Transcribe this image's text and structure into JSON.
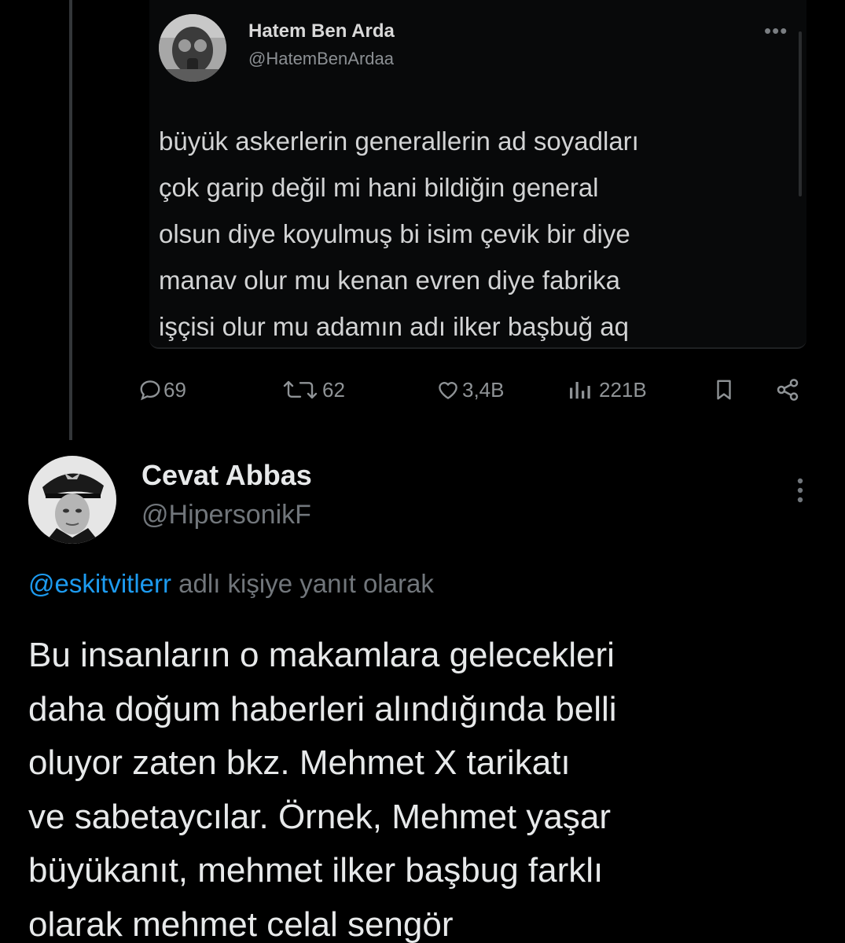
{
  "quoted_tweet": {
    "author_name": "Hatem Ben Arda",
    "author_handle": "@HatemBenArdaa",
    "more_label": "•••",
    "text": "büyük askerlerin generallerin ad soyadları\nçok garip değil mi hani bildiğin general\nolsun diye koyulmuş bi isim çevik bir diye\nmanav olur mu kenan evren diye fabrika\nişçisi olur mu adamın adı ilker başbuğ aq",
    "stats": {
      "replies": "69",
      "retweets": "62",
      "likes": "3,4B",
      "views": "221B"
    },
    "icons": [
      "reply-icon",
      "retweet-icon",
      "like-icon",
      "views-icon",
      "bookmark-icon",
      "share-icon"
    ]
  },
  "tweet": {
    "author_name": "Cevat Abbas",
    "author_handle": "@HipersonikF",
    "reply_mention": "@eskitvitlerr",
    "reply_suffix": " adlı kişiye yanıt olarak",
    "text": "Bu insanların o makamlara gelecekleri\ndaha doğum haberleri alındığında belli\noluyor zaten bkz. Mehmet X tarikatı\nve sabetaycılar. Örnek, Mehmet yaşar\nbüyükanıt, mehmet ilker başbug farklı\nolarak mehmet celal sengör"
  },
  "colors": {
    "background": "#000000",
    "text_primary": "#e7e9ea",
    "text_secondary": "#71767b",
    "accent": "#1d9bf0"
  }
}
